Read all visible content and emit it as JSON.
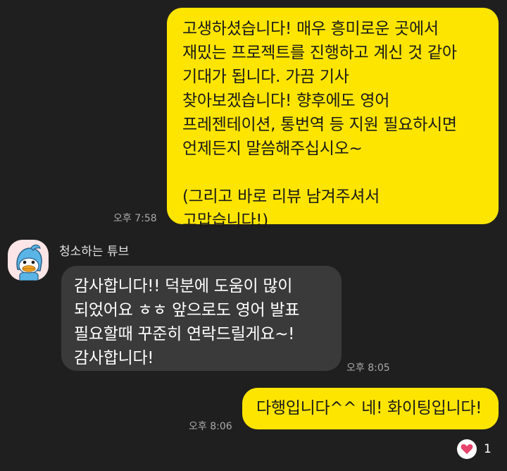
{
  "messages": [
    {
      "sender": "me",
      "text": "고생하셨습니다! 매우 흥미로운 곳에서\n재밌는 프로젝트를 진행하고 계신 것 같아\n기대가 됩니다. 가끔 기사\n찾아보겠습니다! 향후에도 영어\n프레젠테이션, 통번역 등 지원 필요하시면\n언제든지 말씀해주십시오~\n\n(그리고 바로 리뷰 남겨주셔서\n고맙습니다!)",
      "time": "오후 7:58"
    },
    {
      "sender": "other",
      "sender_name": "청소하는 튜브",
      "text": "감사합니다!! 덕분에 도움이 많이\n되었어요 ㅎㅎ 앞으로도 영어 발표\n필요할때 꾸준히 연락드릴게요~!\n감사합니다!",
      "time": "오후 8:05"
    },
    {
      "sender": "me",
      "text": "다행입니다^^ 네! 화이팅입니다!",
      "time": "오후 8:06",
      "reaction": {
        "icon": "heart-icon",
        "count": "1"
      }
    }
  ],
  "colors": {
    "background": "#1f1f1f",
    "my_bubble": "#fee500",
    "other_bubble": "#3a3a3a",
    "time_text": "#a9a9a9",
    "reaction_heart": "#e8436b"
  }
}
